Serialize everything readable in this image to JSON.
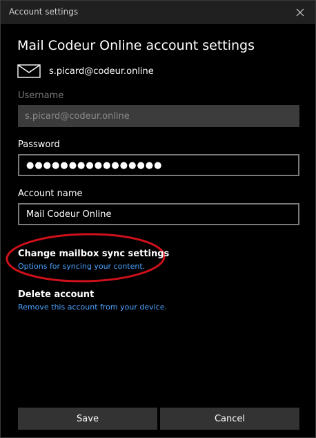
{
  "window": {
    "title": "Account settings"
  },
  "header": {
    "title": "Mail Codeur Online account settings",
    "account_email": "s.picard@codeur.online"
  },
  "form": {
    "username": {
      "label": "Username",
      "value": "s.picard@codeur.online"
    },
    "password": {
      "label": "Password",
      "masked_value": "●●●●●●●●●●●●●●●●"
    },
    "account_name": {
      "label": "Account name",
      "value": "Mail Codeur Online"
    }
  },
  "sync": {
    "title": "Change mailbox sync settings",
    "subtitle": "Options for syncing your content."
  },
  "delete": {
    "title": "Delete account",
    "subtitle": "Remove this account from your device."
  },
  "buttons": {
    "save": "Save",
    "cancel": "Cancel"
  },
  "colors": {
    "background": "#000000",
    "titlebar": "#202020",
    "link": "#4aa3ff",
    "annotation": "#d0101a",
    "button": "#333333"
  },
  "icons": {
    "close": "close-icon",
    "mail": "mail-icon"
  }
}
